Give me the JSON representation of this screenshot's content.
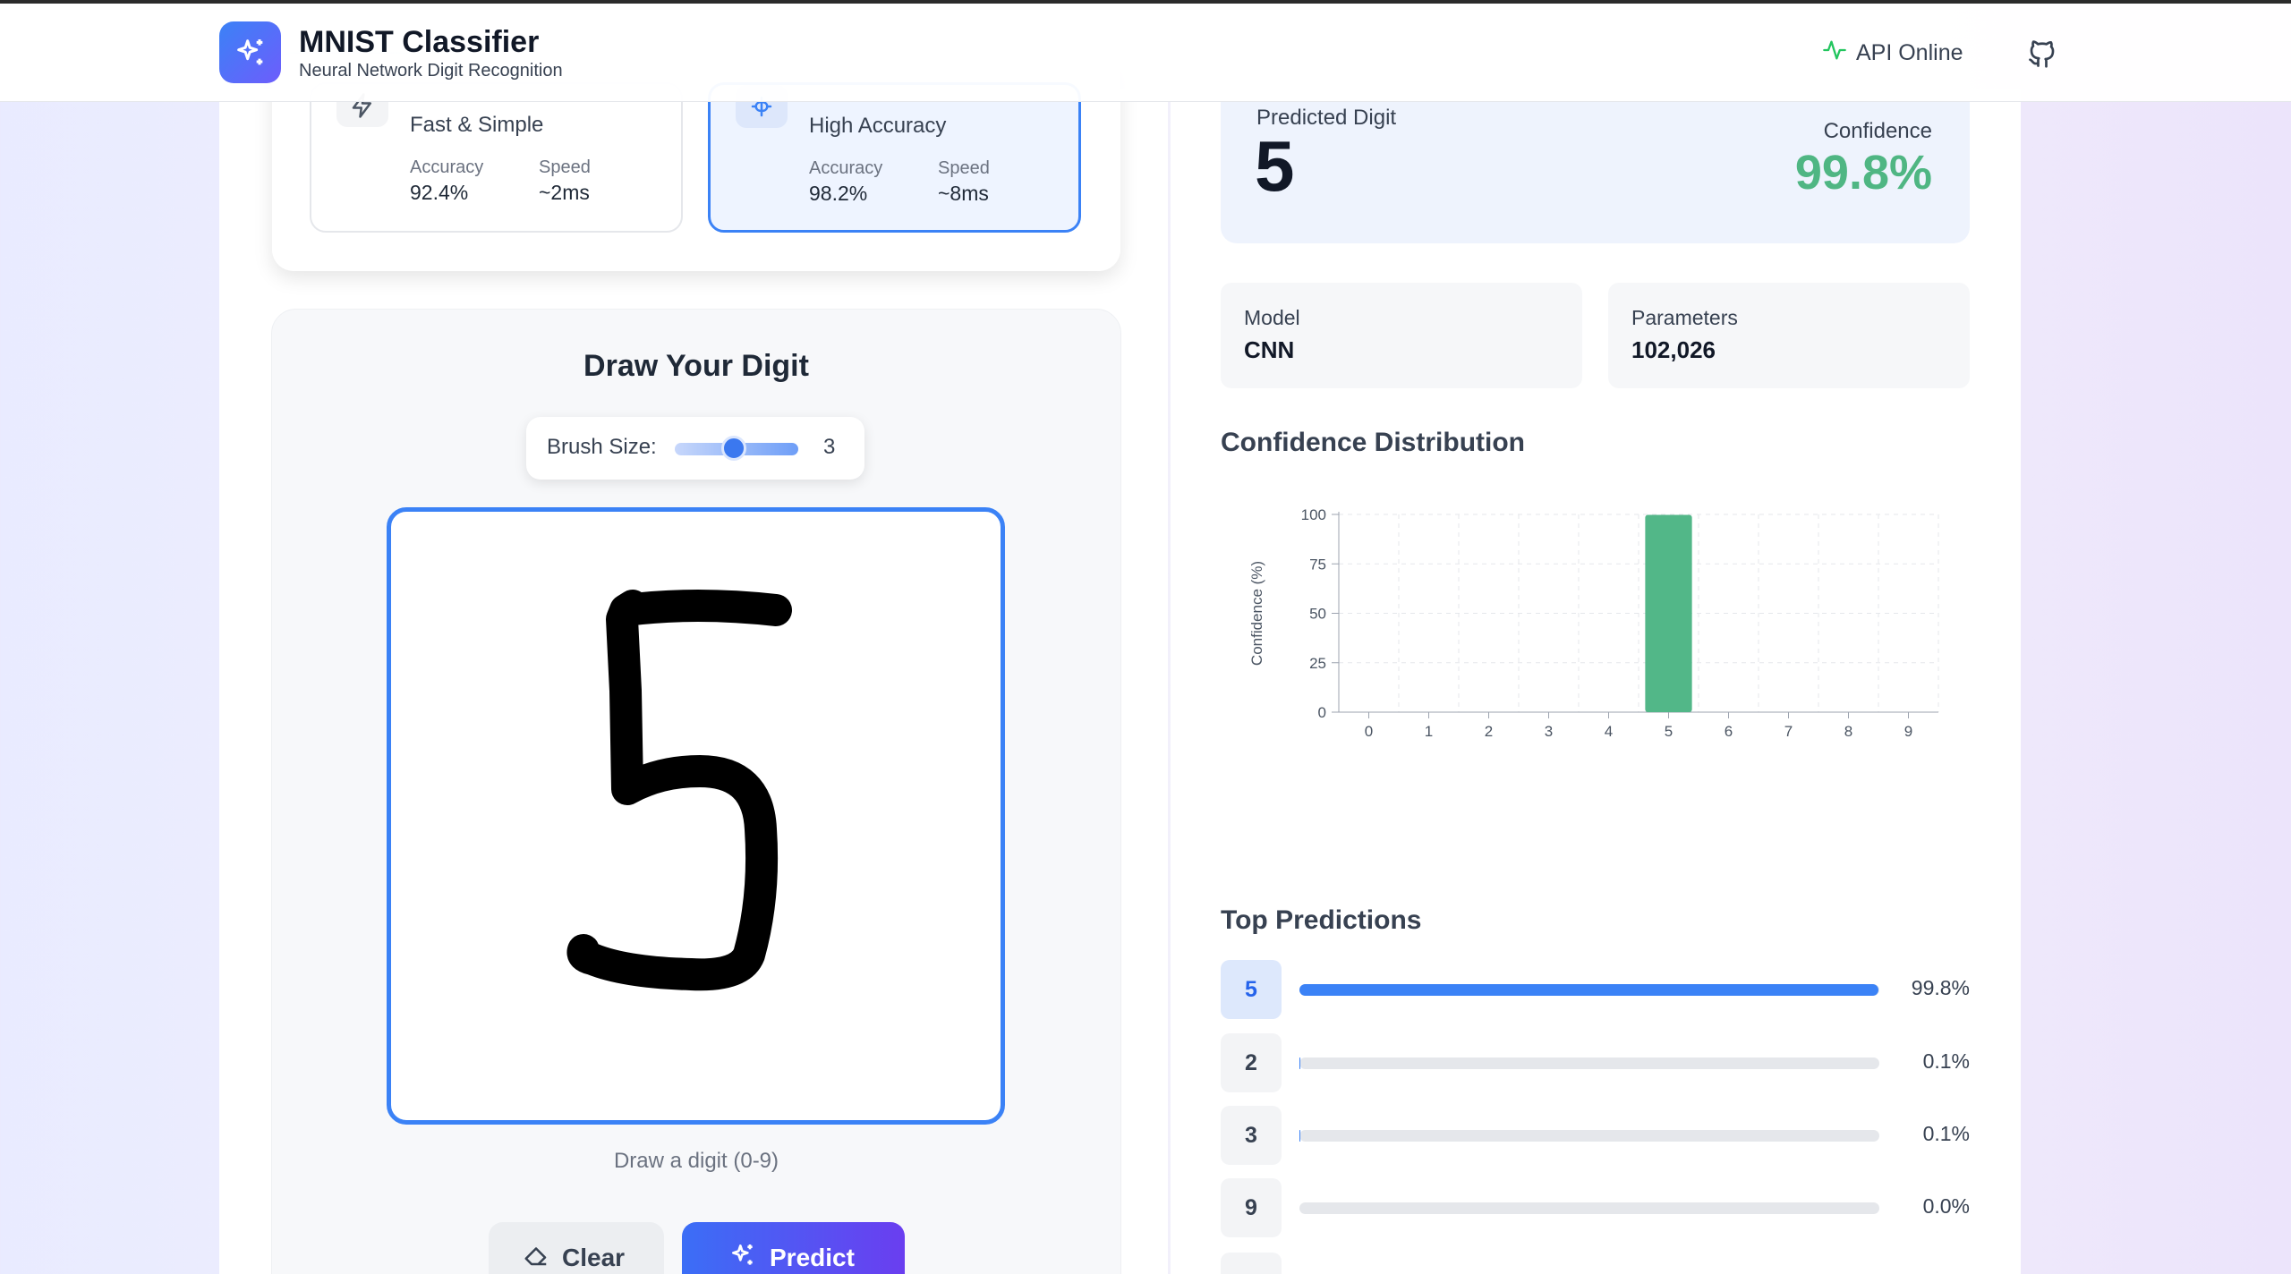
{
  "header": {
    "title": "MNIST Classifier",
    "subtitle": "Neural Network Digit Recognition",
    "api_status": "API Online"
  },
  "models": [
    {
      "description": "Fast & Simple",
      "accuracy_label": "Accuracy",
      "accuracy": "92.4%",
      "speed_label": "Speed",
      "speed": "~2ms",
      "selected": false
    },
    {
      "description": "High Accuracy",
      "accuracy_label": "Accuracy",
      "accuracy": "98.2%",
      "speed_label": "Speed",
      "speed": "~8ms",
      "selected": true
    }
  ],
  "draw": {
    "title": "Draw Your Digit",
    "brush_label": "Brush Size:",
    "brush_value": "3",
    "brush_fraction": 0.5,
    "hint": "Draw a digit (0-9)",
    "clear_label": "Clear",
    "predict_label": "Predict"
  },
  "result": {
    "predicted_label": "Predicted Digit",
    "predicted_digit": "5",
    "confidence_label": "Confidence",
    "confidence": "99.8%",
    "model_label": "Model",
    "model": "CNN",
    "params_label": "Parameters",
    "params": "102,026"
  },
  "colors": {
    "accent": "#3b82f6",
    "success": "#4fb683",
    "bar": "#52b788"
  },
  "icons": {
    "logo": "sparkles-icon",
    "api": "activity-icon",
    "github": "github-icon",
    "simple_model": "zap-icon",
    "cnn_model": "brain-icon",
    "clear": "eraser-icon",
    "predict": "sparkles-icon"
  },
  "chart_data": {
    "type": "bar",
    "title": "Confidence Distribution",
    "xlabel": "",
    "ylabel": "Confidence (%)",
    "categories": [
      "0",
      "1",
      "2",
      "3",
      "4",
      "5",
      "6",
      "7",
      "8",
      "9"
    ],
    "values": [
      0,
      0,
      0.1,
      0.1,
      0,
      99.8,
      0,
      0,
      0,
      0
    ],
    "yticks": [
      "0",
      "25",
      "50",
      "75",
      "100"
    ],
    "ylim": [
      0,
      100
    ],
    "grid": true
  },
  "top_predictions": {
    "title": "Top Predictions",
    "items": [
      {
        "digit": "5",
        "percent": "99.8%",
        "value": 99.8
      },
      {
        "digit": "2",
        "percent": "0.1%",
        "value": 0.1
      },
      {
        "digit": "3",
        "percent": "0.1%",
        "value": 0.1
      },
      {
        "digit": "9",
        "percent": "0.0%",
        "value": 0.0
      }
    ]
  }
}
